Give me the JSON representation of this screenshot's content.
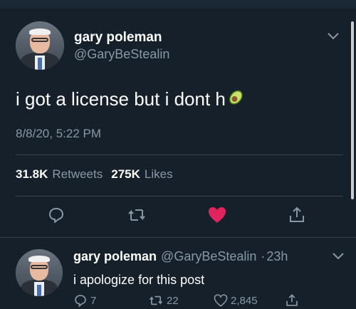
{
  "tweet": {
    "author_name": "gary poleman",
    "author_handle": "@GaryBeStealin",
    "text": "i got a license but i dont h",
    "emoji": "avocado",
    "timestamp": "8/8/20, 5:22 PM",
    "retweets_count": "31.8K",
    "retweets_label": "Retweets",
    "likes_count": "275K",
    "likes_label": "Likes",
    "liked": true,
    "like_color": "#e0245e"
  },
  "reply": {
    "author_name": "gary poleman",
    "author_handle": "@GaryBeStealin",
    "separator": "·",
    "time_ago": "23h",
    "text": "i apologize for this post",
    "reply_count": "7",
    "retweet_count": "22",
    "like_count": "2,845"
  },
  "icons": [
    "chevron-down-icon",
    "reply-icon",
    "retweet-icon",
    "heart-icon",
    "share-icon"
  ],
  "colors": {
    "background": "#15202b",
    "secondary_text": "#8899a6",
    "divider": "#38444d"
  }
}
